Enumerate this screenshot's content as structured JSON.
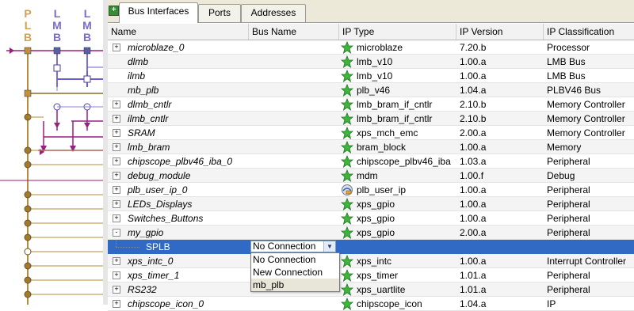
{
  "diagram": {
    "bus_letters": [
      {
        "letters": [
          "P",
          "L",
          "B"
        ],
        "color": "#d4a04a"
      },
      {
        "letters": [
          "L",
          "M",
          "B"
        ],
        "color": "#7a6bd1"
      },
      {
        "letters": [
          "L",
          "M",
          "B"
        ],
        "color": "#7a6bd1"
      }
    ],
    "colors": {
      "plb": "#b88a3a",
      "lmb": "#6a5fc8",
      "connector": "#9b1f80",
      "node": "#a07a30"
    }
  },
  "tabs": {
    "items": [
      {
        "label": "Bus Interfaces",
        "active": true
      },
      {
        "label": "Ports",
        "active": false
      },
      {
        "label": "Addresses",
        "active": false
      }
    ]
  },
  "table": {
    "columns": [
      "Name",
      "Bus Name",
      "IP Type",
      "IP Version",
      "IP Classification"
    ],
    "rows": [
      {
        "name": "microblaze_0",
        "expander": "+",
        "bus": "",
        "ip_type": "microblaze",
        "icon": "star",
        "version": "7.20.b",
        "classification": "Processor"
      },
      {
        "name": "dlmb",
        "expander": "",
        "bus": "",
        "ip_type": "lmb_v10",
        "icon": "star",
        "version": "1.00.a",
        "classification": "LMB Bus"
      },
      {
        "name": "ilmb",
        "expander": "",
        "bus": "",
        "ip_type": "lmb_v10",
        "icon": "star",
        "version": "1.00.a",
        "classification": "LMB Bus"
      },
      {
        "name": "mb_plb",
        "expander": "",
        "bus": "",
        "ip_type": "plb_v46",
        "icon": "star",
        "version": "1.04.a",
        "classification": "PLBV46 Bus"
      },
      {
        "name": "dlmb_cntlr",
        "expander": "+",
        "bus": "",
        "ip_type": "lmb_bram_if_cntlr",
        "icon": "star",
        "version": "2.10.b",
        "classification": "Memory Controller"
      },
      {
        "name": "ilmb_cntlr",
        "expander": "+",
        "bus": "",
        "ip_type": "lmb_bram_if_cntlr",
        "icon": "star",
        "version": "2.10.b",
        "classification": "Memory Controller"
      },
      {
        "name": "SRAM",
        "expander": "+",
        "bus": "",
        "ip_type": "xps_mch_emc",
        "icon": "star",
        "version": "2.00.a",
        "classification": "Memory Controller"
      },
      {
        "name": "lmb_bram",
        "expander": "+",
        "bus": "",
        "ip_type": "bram_block",
        "icon": "star",
        "version": "1.00.a",
        "classification": "Memory"
      },
      {
        "name": "chipscope_plbv46_iba_0",
        "expander": "+",
        "bus": "",
        "ip_type": "chipscope_plbv46_iba",
        "icon": "star",
        "version": "1.03.a",
        "classification": "Peripheral"
      },
      {
        "name": "debug_module",
        "expander": "+",
        "bus": "",
        "ip_type": "mdm",
        "icon": "star",
        "version": "1.00.f",
        "classification": "Debug"
      },
      {
        "name": "plb_user_ip_0",
        "expander": "+",
        "bus": "",
        "ip_type": "plb_user_ip",
        "icon": "user",
        "version": "1.00.a",
        "classification": "Peripheral"
      },
      {
        "name": "LEDs_Displays",
        "expander": "+",
        "bus": "",
        "ip_type": "xps_gpio",
        "icon": "star",
        "version": "1.00.a",
        "classification": "Peripheral"
      },
      {
        "name": "Switches_Buttons",
        "expander": "+",
        "bus": "",
        "ip_type": "xps_gpio",
        "icon": "star",
        "version": "1.00.a",
        "classification": "Peripheral"
      },
      {
        "name": "my_gpio",
        "expander": "-",
        "bus": "",
        "ip_type": "xps_gpio",
        "icon": "star",
        "version": "2.00.a",
        "classification": "Peripheral"
      },
      {
        "name": "SPLB",
        "expander": "",
        "child": true,
        "selected": true,
        "bus": "No Connection",
        "ip_type": "",
        "icon": "",
        "version": "",
        "classification": ""
      },
      {
        "name": "xps_intc_0",
        "expander": "+",
        "bus": "",
        "ip_type": "xps_intc",
        "icon": "star",
        "version": "1.00.a",
        "classification": "Interrupt Controller"
      },
      {
        "name": "xps_timer_1",
        "expander": "+",
        "bus": "",
        "ip_type": "xps_timer",
        "icon": "star",
        "version": "1.01.a",
        "classification": "Peripheral"
      },
      {
        "name": "RS232",
        "expander": "+",
        "bus": "",
        "ip_type": "xps_uartlite",
        "icon": "star",
        "version": "1.01.a",
        "classification": "Peripheral"
      },
      {
        "name": "chipscope_icon_0",
        "expander": "+",
        "bus": "",
        "ip_type": "chipscope_icon",
        "icon": "star",
        "version": "1.04.a",
        "classification": "IP"
      }
    ]
  },
  "dropdown": {
    "selected": "No Connection",
    "options": [
      "No Connection",
      "New Connection",
      "mb_plb"
    ],
    "hover_index": 2
  },
  "colors": {
    "selection": "#316ac5",
    "star_green": "#3fb43f",
    "tab_bg": "#ece9d8"
  }
}
